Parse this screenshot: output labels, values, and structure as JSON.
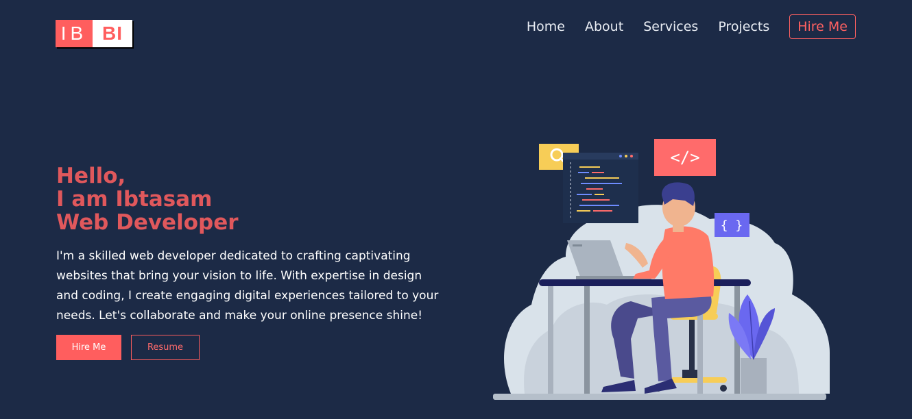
{
  "logo": {
    "part1": "IB",
    "part2": "BI"
  },
  "nav": {
    "items": [
      "Home",
      "About",
      "Services",
      "Projects"
    ],
    "cta": "Hire Me"
  },
  "hero": {
    "line1": "Hello,",
    "line2": "I am Ibtasam",
    "line3": "Web Developer",
    "description": "I'm a skilled web developer dedicated to crafting captivating websites that bring your vision to life. With expertise in design and coding, I create engaging digital experiences tailored to your needs. Let's collaborate and make your online presence shine!",
    "primary_button": "Hire Me",
    "secondary_button": "Resume"
  },
  "illustration": {
    "code_tag": "</>",
    "braces": "{ }",
    "search_icon": "search-icon"
  },
  "colors": {
    "background": "#1c2a46",
    "accent": "#ff5e5e",
    "headline": "#e0585c"
  }
}
